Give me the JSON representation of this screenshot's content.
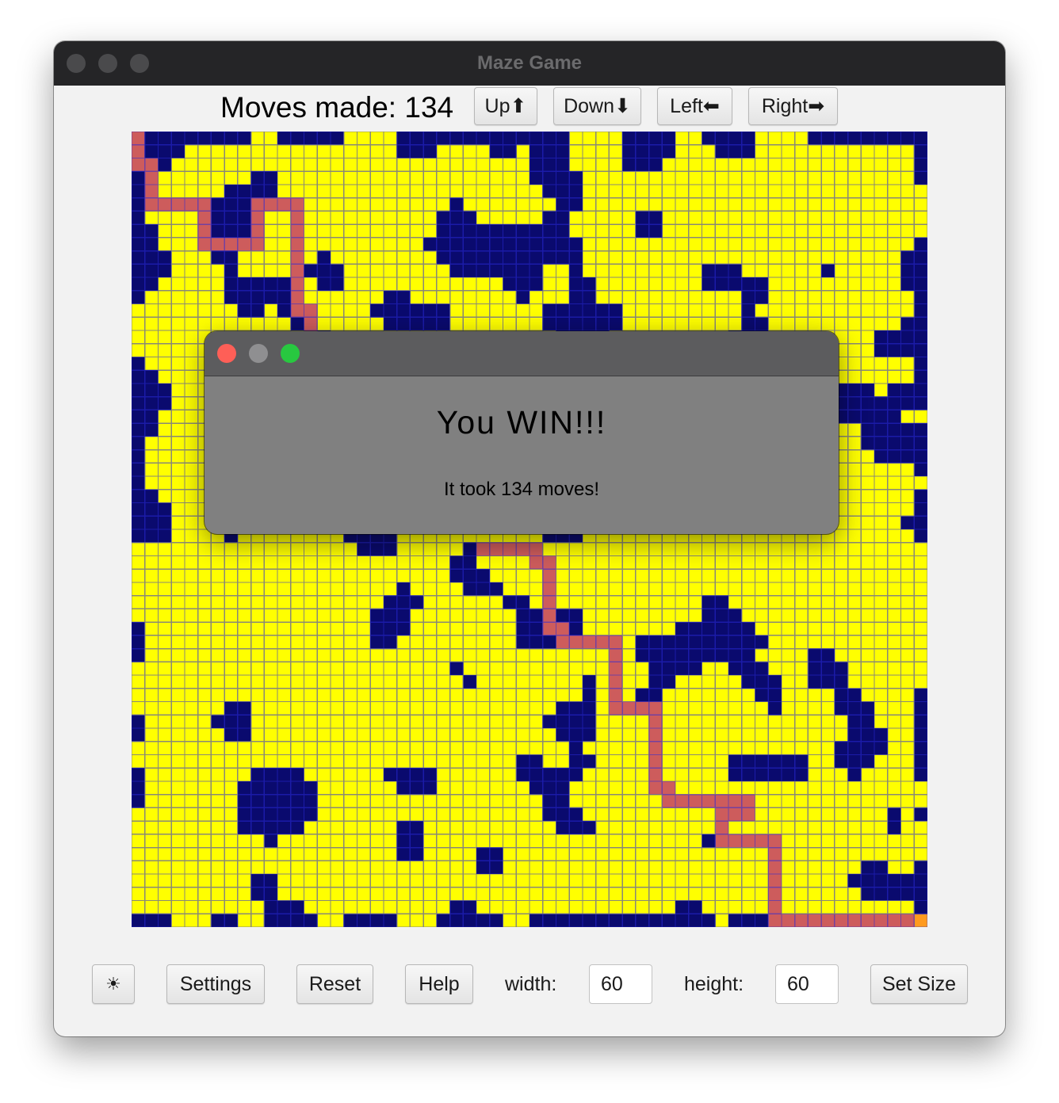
{
  "window": {
    "title": "Maze Game"
  },
  "header": {
    "moves_label": "Moves made: 134",
    "buttons": {
      "up": "Up⬆",
      "down": "Down⬇",
      "left": "Left⬅",
      "right": "Right➡"
    }
  },
  "maze": {
    "grid_size": 60,
    "colors": {
      "open": "#ffff00",
      "wall": "#0a0a6e",
      "grid_line": "#2a2ad8",
      "path": "#cd5c5c",
      "exit": "#ff9a1f"
    }
  },
  "dialog": {
    "message": "You WIN!!!",
    "detail": "It took 134 moves!"
  },
  "footer": {
    "theme_icon": "☀",
    "settings": "Settings",
    "reset": "Reset",
    "help": "Help",
    "width_label": "width:",
    "width_value": "60",
    "height_label": "height:",
    "height_value": "60",
    "set_size": "Set Size"
  }
}
